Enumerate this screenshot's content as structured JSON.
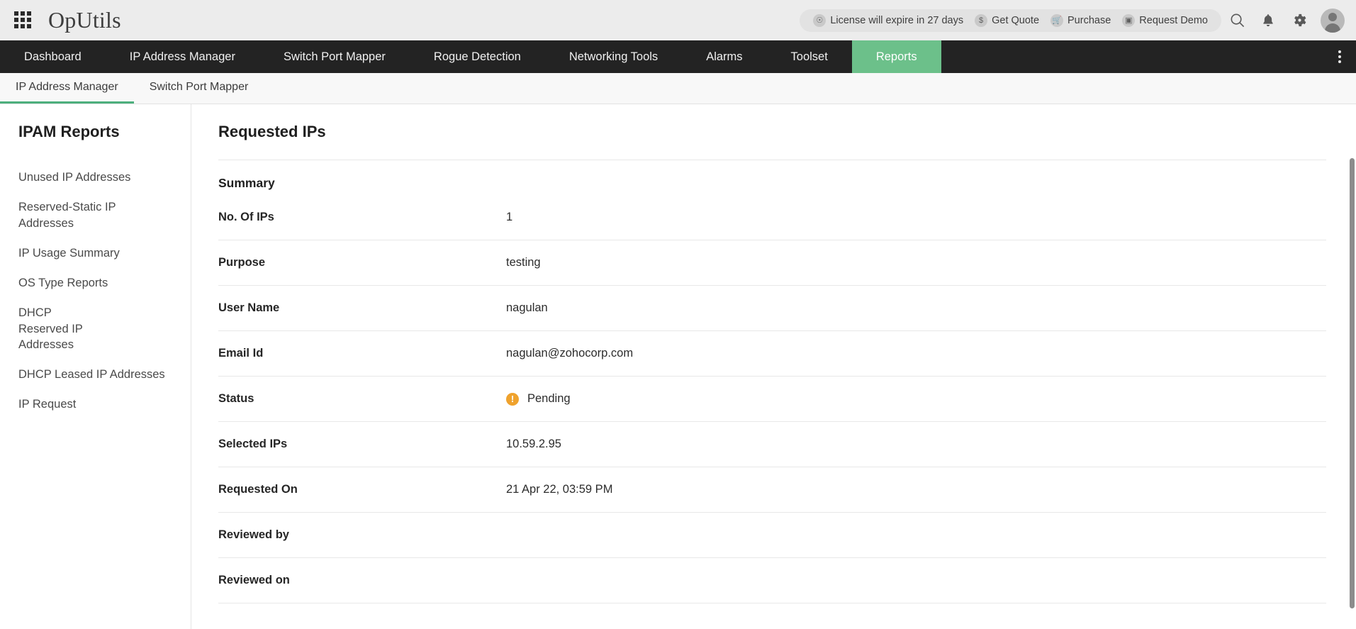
{
  "header": {
    "app_menu_icon": "grid-apps-icon",
    "brand": "OpUtils",
    "license_items": [
      {
        "icon": "license-key-icon",
        "label": "License will expire in 27 days"
      },
      {
        "icon": "dollar-icon",
        "label": "Get Quote"
      },
      {
        "icon": "cart-icon",
        "label": "Purchase"
      },
      {
        "icon": "monitor-icon",
        "label": "Request Demo"
      }
    ],
    "actions": [
      {
        "icon": "search-icon",
        "glyph": "⌕"
      },
      {
        "icon": "bell-icon",
        "glyph": "ὑ4"
      },
      {
        "icon": "gear-icon",
        "glyph": "⚙"
      }
    ],
    "avatar": "user-avatar"
  },
  "main_nav": {
    "items": [
      {
        "label": "Dashboard",
        "active": false
      },
      {
        "label": "IP Address Manager",
        "active": false
      },
      {
        "label": "Switch Port Mapper",
        "active": false
      },
      {
        "label": "Rogue Detection",
        "active": false
      },
      {
        "label": "Networking Tools",
        "active": false
      },
      {
        "label": "Alarms",
        "active": false
      },
      {
        "label": "Toolset",
        "active": false
      },
      {
        "label": "Reports",
        "active": true
      }
    ],
    "active_color": "#6cc08a",
    "overflow_icon": "kebab-menu-icon"
  },
  "sub_nav": {
    "items": [
      {
        "label": "IP Address Manager",
        "active": true
      },
      {
        "label": "Switch Port Mapper",
        "active": false
      }
    ],
    "active_underline_color": "#4caf7d"
  },
  "sidebar": {
    "title": "IPAM Reports",
    "items": [
      {
        "label": "Unused IP Addresses"
      },
      {
        "label": "Reserved-Static IP Addresses"
      },
      {
        "label": "IP Usage Summary"
      },
      {
        "label": "OS Type Reports"
      },
      {
        "label": "DHCP Reserved IP Addresses"
      },
      {
        "label": "DHCP Leased IP Addresses"
      },
      {
        "label": "IP Request"
      }
    ]
  },
  "main": {
    "page_title": "Requested IPs",
    "section_title": "Summary",
    "rows": [
      {
        "label": "No. Of IPs",
        "value": "1",
        "status": false
      },
      {
        "label": "Purpose",
        "value": "testing",
        "status": false
      },
      {
        "label": "User Name",
        "value": "nagulan",
        "status": false
      },
      {
        "label": "Email Id",
        "value": "nagulan@zohocorp.com",
        "status": false
      },
      {
        "label": "Status",
        "value": "Pending",
        "status": true,
        "status_color": "#efa22d",
        "status_glyph": "!"
      },
      {
        "label": "Selected IPs",
        "value": "10.59.2.95",
        "status": false
      },
      {
        "label": "Requested On",
        "value": "21 Apr 22, 03:59 PM",
        "status": false
      },
      {
        "label": "Reviewed by",
        "value": "",
        "status": false
      },
      {
        "label": "Reviewed on",
        "value": "",
        "status": false
      }
    ]
  },
  "scrollbar": {
    "name": "vertical-scrollbar"
  }
}
